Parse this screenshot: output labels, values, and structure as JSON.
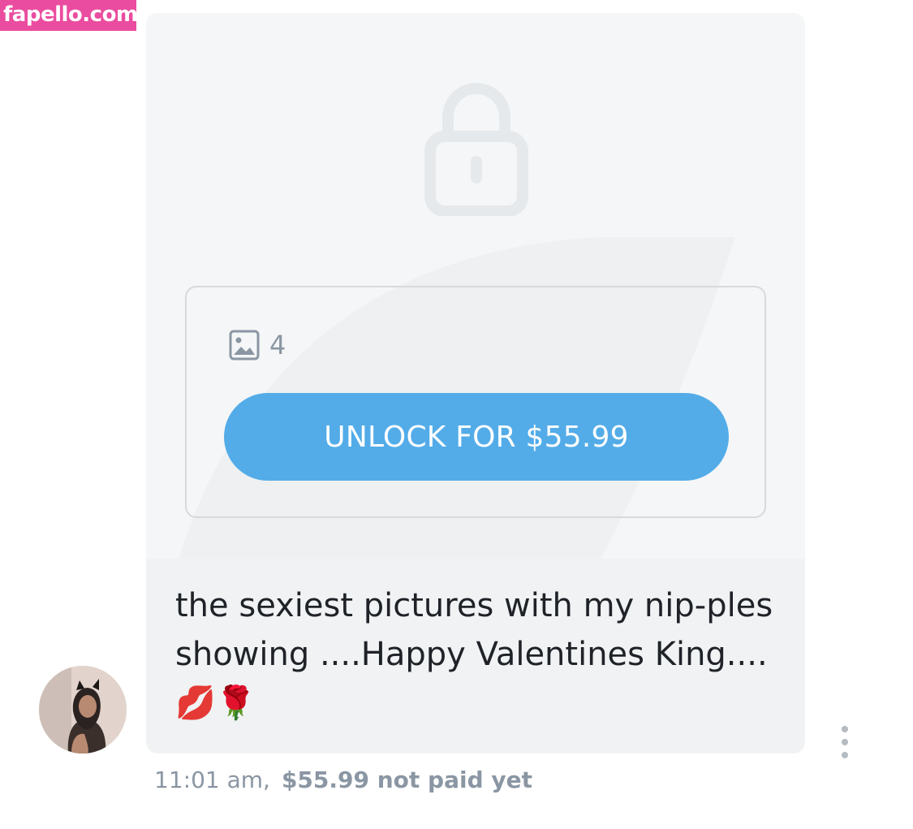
{
  "watermark": {
    "text": "fapello.com",
    "color": "#ea4c9f"
  },
  "message": {
    "media": {
      "locked": true,
      "lock_icon": "lock-icon",
      "media_type_icon": "image-icon",
      "count": "4"
    },
    "unlock_button_label": "UNLOCK FOR $55.99",
    "text": "the sexiest pictures with my nip-ples showing ....Happy Valentines King.... 💋🌹",
    "time": "11:01 am,",
    "price_status": "$55.99 not paid yet"
  },
  "avatar": {
    "icon": "user-avatar"
  },
  "menu": {
    "icon": "more-vertical-icon"
  },
  "colors": {
    "accent": "#53ace8",
    "bubble": "#f0f2f3",
    "muted_text": "#8a96a3",
    "body_text": "#1f2328"
  }
}
